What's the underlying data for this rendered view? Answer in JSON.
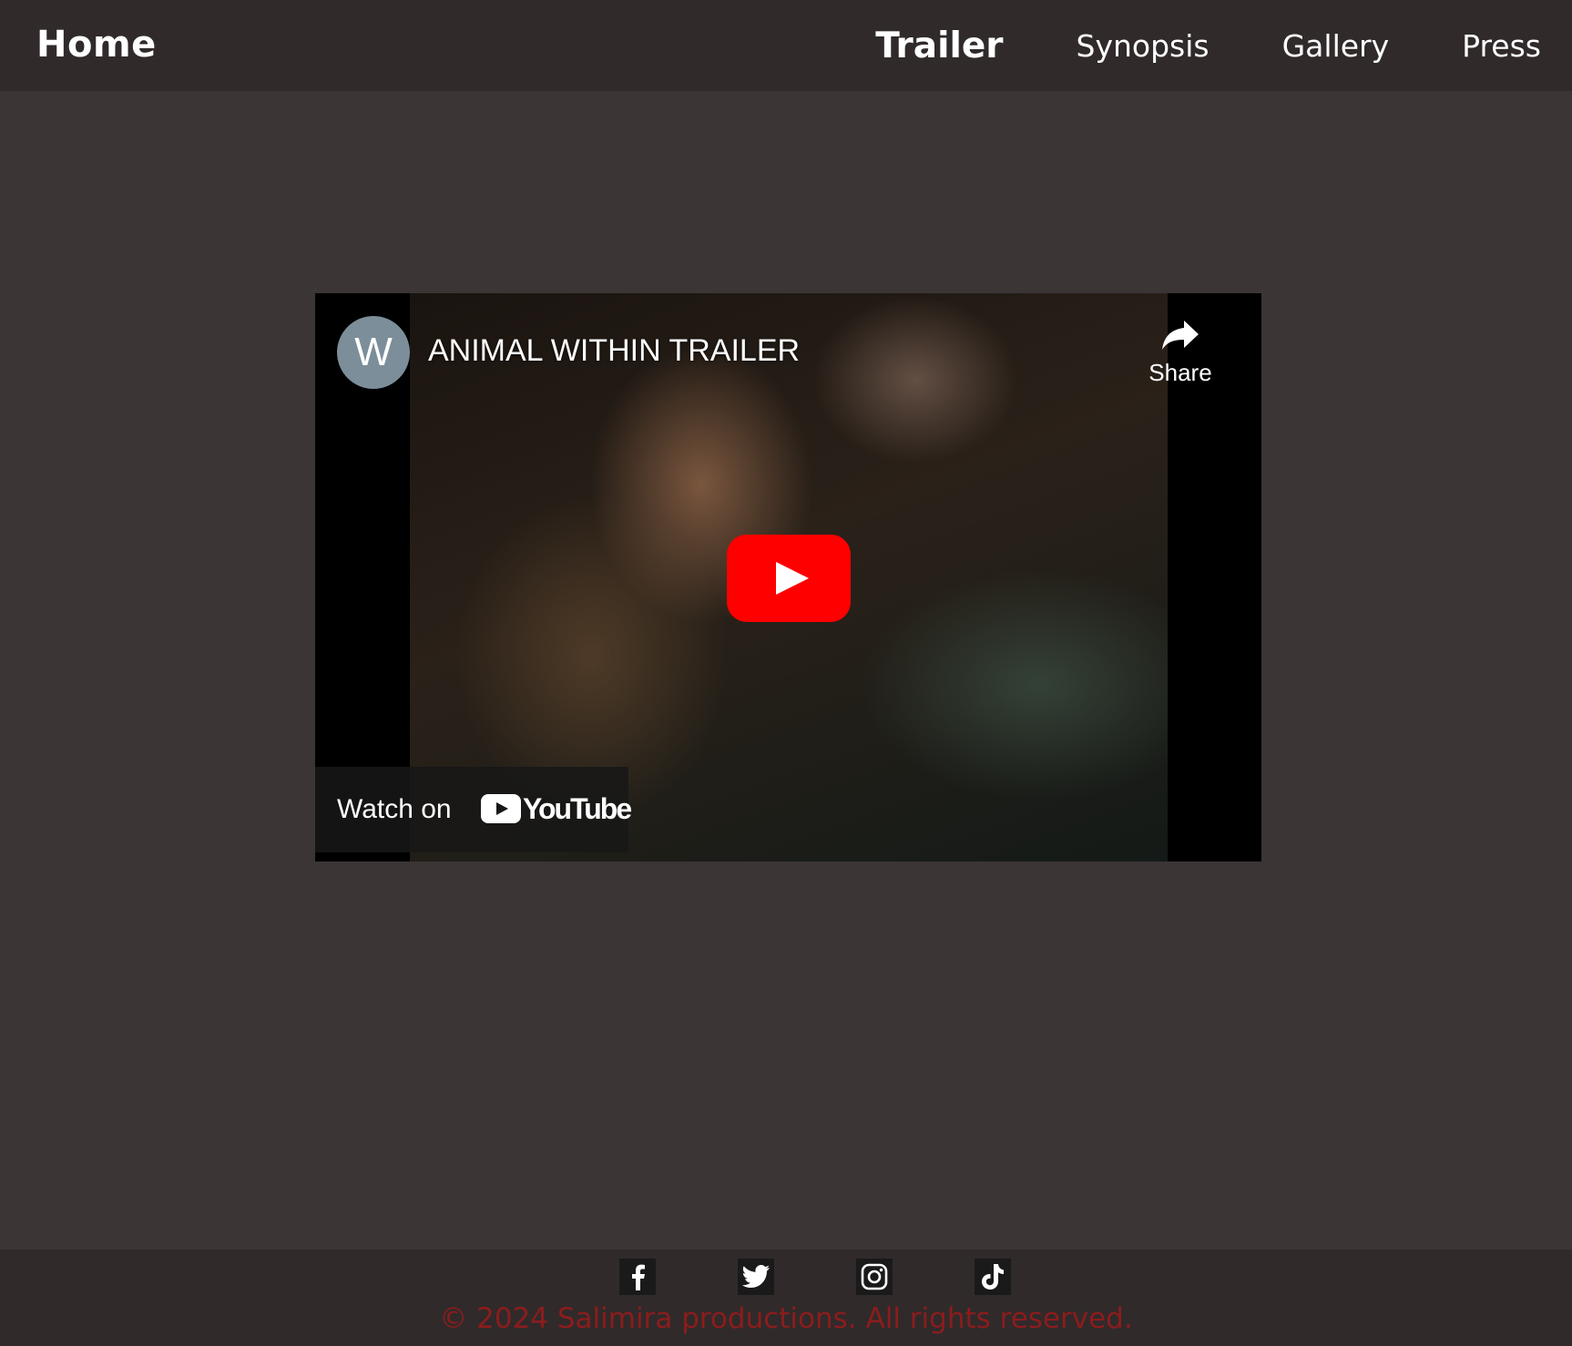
{
  "header": {
    "brand": "Home",
    "nav": [
      {
        "label": "Trailer",
        "active": true
      },
      {
        "label": "Synopsis",
        "active": false
      },
      {
        "label": "Gallery",
        "active": false
      },
      {
        "label": "Press",
        "active": false
      }
    ]
  },
  "video": {
    "channel_initial": "W",
    "title": "ANIMAL WITHIN TRAILER",
    "share_label": "Share",
    "watch_on_label": "Watch on",
    "platform": "YouTube",
    "play_icon": "play-icon"
  },
  "footer": {
    "socials": [
      "facebook-icon",
      "twitter-icon",
      "instagram-icon",
      "tiktok-icon"
    ],
    "copyright": "© 2024 Salimira productions. All rights reserved."
  },
  "colors": {
    "page_bg": "#3b3536",
    "header_bg": "#302a2b",
    "play_red": "#ff0000",
    "copyright_red": "#8c1c1c"
  }
}
